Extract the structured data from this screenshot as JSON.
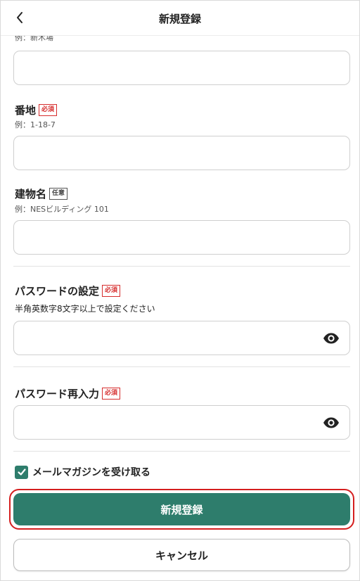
{
  "header": {
    "title": "新規登録"
  },
  "town_field": {
    "example_cut": "例：新木場",
    "value": ""
  },
  "street_field": {
    "label": "番地",
    "badge": "必須",
    "example": "例：1-18-7",
    "value": ""
  },
  "building_field": {
    "label": "建物名",
    "badge": "任意",
    "example": "例：NESビルディング 101",
    "value": ""
  },
  "password_field": {
    "label": "パスワードの設定",
    "badge": "必須",
    "hint": "半角英数字8文字以上で設定ください",
    "value": ""
  },
  "password_confirm_field": {
    "label": "パスワード再入力",
    "badge": "必須",
    "value": ""
  },
  "newsletter": {
    "label": "メールマガジンを受け取る",
    "checked": true
  },
  "actions": {
    "submit_label": "新規登録",
    "cancel_label": "キャンセル"
  },
  "colors": {
    "accent": "#2e7d6c",
    "required": "#d62d2d",
    "focus": "#d51f1f"
  },
  "icons": {
    "back": "chevron-left-icon",
    "eye": "eye-icon",
    "check": "checkmark-icon"
  }
}
